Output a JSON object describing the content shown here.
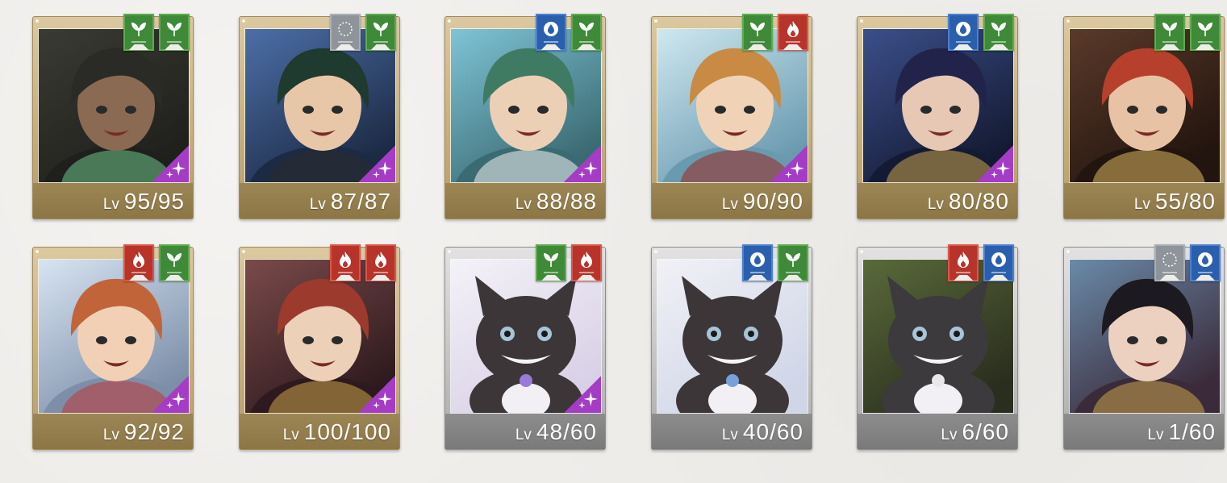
{
  "level_tag": "Lv",
  "colors": {
    "green": "#3e8a38",
    "red": "#b8332a",
    "blue": "#2a5fae",
    "gray": "#8e949a",
    "sparkle": "#a43cc6",
    "gold_frame": "#c8b07c",
    "silver_frame": "#c4c4c4"
  },
  "cards": [
    {
      "level": "95/95",
      "frame": "gold",
      "flags": [
        "green-leaf-icon",
        "green-leaf-icon"
      ],
      "sparkle": true,
      "art": "dark-long-hair-character-portrait"
    },
    {
      "level": "87/87",
      "frame": "gold",
      "flags": [
        "gray-ring-icon",
        "green-leaf-icon"
      ],
      "sparkle": true,
      "art": "top-hat-glasses-character-portrait"
    },
    {
      "level": "88/88",
      "frame": "gold",
      "flags": [
        "blue-drop-icon",
        "green-leaf-icon"
      ],
      "sparkle": true,
      "art": "white-hat-glasses-character-portrait"
    },
    {
      "level": "90/90",
      "frame": "gold",
      "flags": [
        "green-leaf-icon",
        "red-flame-icon"
      ],
      "sparkle": true,
      "art": "curly-blond-character-portrait"
    },
    {
      "level": "80/80",
      "frame": "gold",
      "flags": [
        "blue-drop-icon",
        "green-leaf-icon"
      ],
      "sparkle": true,
      "art": "stitched-headband-character-portrait"
    },
    {
      "level": "55/80",
      "frame": "gold",
      "flags": [
        "green-leaf-icon",
        "green-leaf-icon"
      ],
      "sparkle": false,
      "art": "red-hair-hat-character-portrait"
    },
    {
      "level": "92/92",
      "frame": "gold",
      "flags": [
        "red-flame-icon",
        "green-leaf-icon"
      ],
      "sparkle": true,
      "art": "orange-hair-character-portrait"
    },
    {
      "level": "100/100",
      "frame": "gold",
      "flags": [
        "red-flame-icon",
        "red-flame-icon"
      ],
      "sparkle": true,
      "art": "crimson-hair-character-portrait"
    },
    {
      "level": "48/60",
      "frame": "silver",
      "flags": [
        "green-leaf-icon",
        "red-flame-icon"
      ],
      "sparkle": true,
      "art": "cat-mascot-portrait"
    },
    {
      "level": "40/60",
      "frame": "silver",
      "flags": [
        "blue-drop-icon",
        "green-leaf-icon"
      ],
      "sparkle": false,
      "art": "cat-mascot-wink-portrait"
    },
    {
      "level": "6/60",
      "frame": "silver",
      "flags": [
        "red-flame-icon",
        "blue-drop-icon"
      ],
      "sparkle": false,
      "art": "cat-mascot-goggles-portrait"
    },
    {
      "level": "1/60",
      "frame": "silver",
      "flags": [
        "gray-ring-icon",
        "blue-drop-icon"
      ],
      "sparkle": false,
      "art": "gold-crown-character-portrait"
    }
  ]
}
